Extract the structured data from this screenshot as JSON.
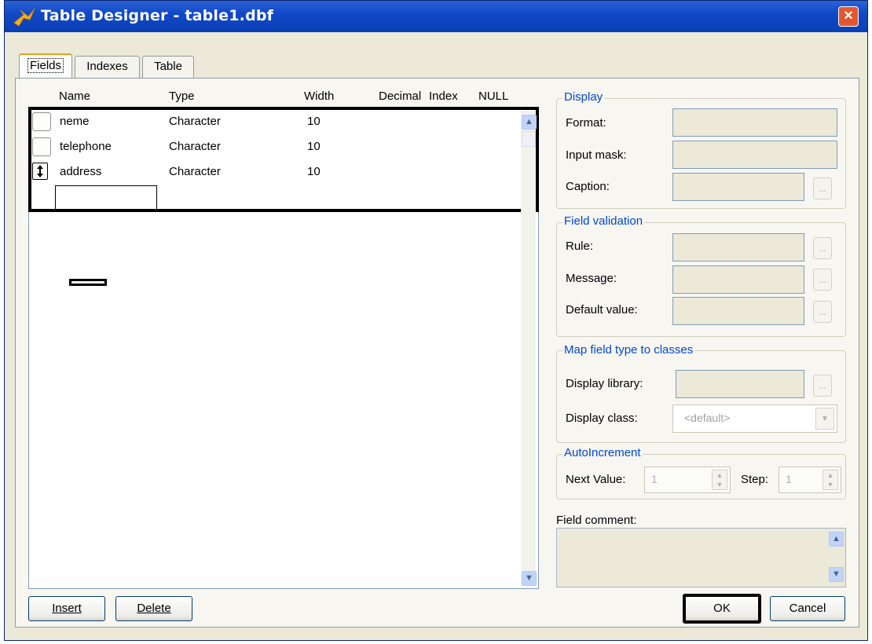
{
  "window": {
    "title": "Table Designer - table1.dbf",
    "close_glyph": "×"
  },
  "tabs": [
    {
      "label": "Fields"
    },
    {
      "label": "Indexes"
    },
    {
      "label": "Table"
    }
  ],
  "grid": {
    "headers": [
      "Name",
      "Type",
      "Width",
      "Decimal",
      "Index",
      "NULL"
    ],
    "rows": [
      {
        "name": "neme",
        "type": "Character",
        "width": "10"
      },
      {
        "name": "telephone",
        "type": "Character",
        "width": "10"
      },
      {
        "name": "address",
        "type": "Character",
        "width": "10"
      }
    ]
  },
  "display": {
    "title": "Display",
    "format_label": "Format:",
    "input_mask_label": "Input mask:",
    "caption_label": "Caption:"
  },
  "validation": {
    "title": "Field validation",
    "rule_label": "Rule:",
    "message_label": "Message:",
    "default_label": "Default value:"
  },
  "map": {
    "title": "Map field type to classes",
    "library_label": "Display library:",
    "class_label": "Display class:",
    "class_value": "<default>"
  },
  "autoinc": {
    "title": "AutoIncrement",
    "next_label": "Next Value:",
    "next_value": "1",
    "step_label": "Step:",
    "step_value": "1"
  },
  "comment": {
    "label": "Field comment:"
  },
  "buttons": {
    "insert": "Insert",
    "delete": "Delete",
    "ok": "OK",
    "cancel": "Cancel",
    "ellipsis": "..."
  },
  "icons": {
    "app": "table-designer-icon",
    "row_move": "move-arrows-icon"
  }
}
